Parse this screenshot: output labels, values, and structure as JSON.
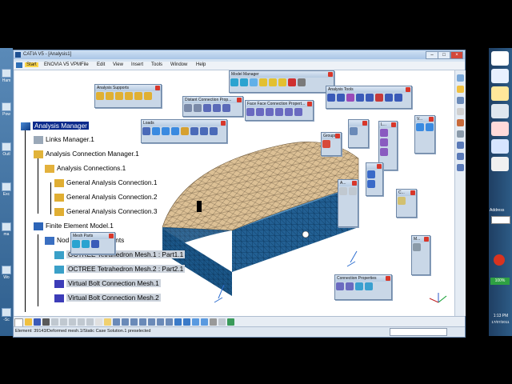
{
  "window": {
    "title": "CATIA V5 - [Analysis1]",
    "menu": [
      "Start",
      "ENOVIA V5 VPM",
      "File",
      "Edit",
      "View",
      "Insert",
      "Tools",
      "Window",
      "Help"
    ],
    "buttons": {
      "minimize": "–",
      "maximize": "□",
      "close": "×"
    }
  },
  "tree": {
    "root": "Analysis Manager",
    "links": "Links Manager.1",
    "acm": "Analysis Connection Manager.1",
    "connections": "Analysis Connections.1",
    "gac1": "General Analysis Connection.1",
    "gac2": "General Analysis Connection.2",
    "gac3": "General Analysis Connection.3",
    "fem": "Finite Element Model.1",
    "nodes": "Nod",
    "nodes_tail": "nts",
    "octree1": "OCTREE Tetrahedron Mesh.1 : Part1.1",
    "octree2": "OCTREE Tetrahedron Mesh.2 : Part2.1",
    "vbolt1": "Virtual Bolt Connection Mesh.1",
    "vbolt2": "Virtual Bolt Connection Mesh.2"
  },
  "toolbars": {
    "analysis_supports": "Analysis Supports",
    "model_manager": "Model Manager",
    "analysis_tools": "Analysis Tools",
    "distant_connection": "Distant Connection Prop...",
    "face_face": "Face Face Connection Propert...",
    "loads": "Loads",
    "groups": "Groups",
    "mesh_parts": "Mesh Parts",
    "connection_properties": "Connection Properties",
    "small_a": "A...",
    "small_c": "C...",
    "small_m": "M...",
    "small_v": "V...",
    "small_l": "L..."
  },
  "status_text": "Element: 39143/Deformed mesh.1/Static Case Solution.1 preselected",
  "desktop_left": [
    "Ham",
    "Pow",
    "Outl",
    "Exc",
    "ma",
    "Wo",
    "-Sc"
  ],
  "taskbar": {
    "address_label": "Address",
    "battery": "100%",
    "time": "1:13 PM",
    "date": "17/07/2011"
  },
  "colors": {
    "tree_highlight": "#0a2a8c",
    "mesh_top": "#d9b98f",
    "mesh_side": "#1e5a8c",
    "accent": "#6f8fb5"
  }
}
